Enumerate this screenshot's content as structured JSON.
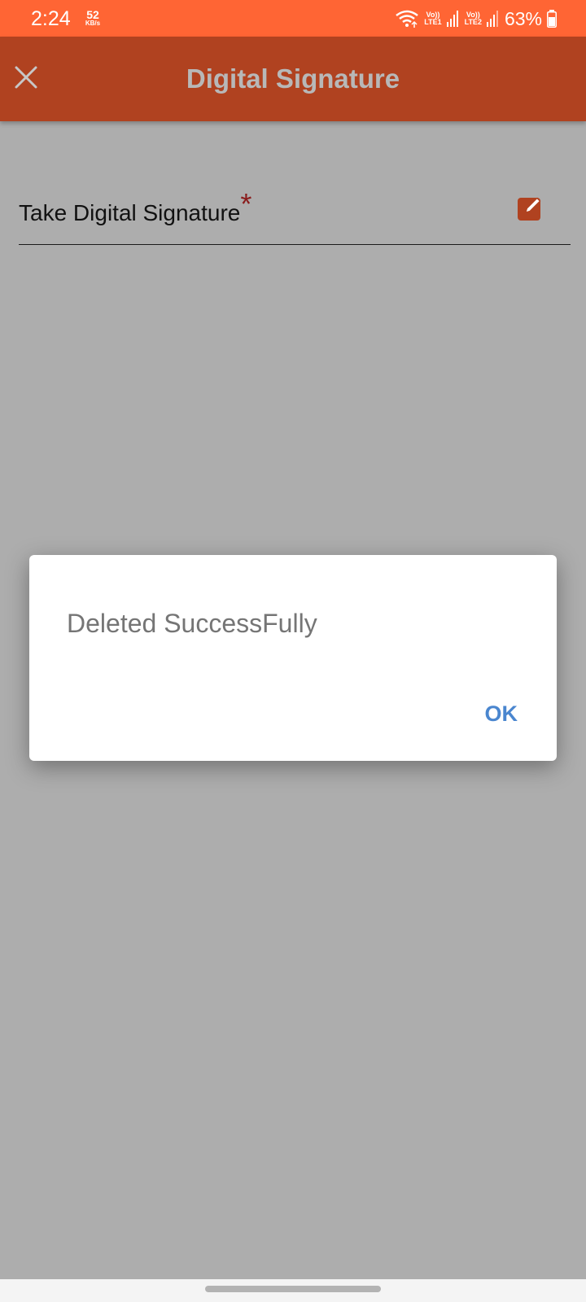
{
  "status_bar": {
    "time": "2:24",
    "net_speed_value": "52",
    "net_speed_unit": "KB/s",
    "sim1_top": "Vo))",
    "sim1_bottom": "LTE1",
    "sim2_top": "Vo))",
    "sim2_bottom": "LTE2",
    "battery": "63%",
    "icons": [
      "wifi-icon",
      "signal-icon",
      "signal-icon",
      "battery-icon"
    ]
  },
  "app_bar": {
    "title": "Digital Signature",
    "close_icon": "close-icon"
  },
  "form": {
    "signature_label": "Take Digital Signature",
    "required_marker": "*",
    "edit_icon": "edit-icon"
  },
  "dialog": {
    "message": "Deleted SuccessFully",
    "ok_label": "OK"
  },
  "colors": {
    "status_bar": "#ff6534",
    "app_bar": "#b04220",
    "scrim": "#adadad",
    "accent_button": "#4a86cf",
    "required": "#8a1c1c"
  }
}
